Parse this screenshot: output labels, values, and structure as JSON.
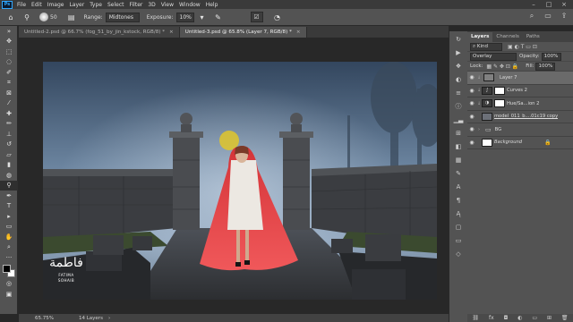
{
  "menubar": {
    "app_logo": "Ps",
    "items": [
      "File",
      "Edit",
      "Image",
      "Layer",
      "Type",
      "Select",
      "Filter",
      "3D",
      "View",
      "Window",
      "Help"
    ]
  },
  "options": {
    "range_label": "Range:",
    "range_value": "Midtones",
    "exposure_label": "Exposure:",
    "exposure_value": "10%",
    "brush_size": "50"
  },
  "tabs": [
    {
      "label": "Untitled-2.psd @ 66.7% (fog_51_by_jin_kstock, RGB/8) *",
      "close": "×"
    },
    {
      "label": "Untitled-3.psd @ 65.8% (Layer 7, RGB/8) *",
      "close": "×"
    }
  ],
  "status": {
    "zoom": "65.75%",
    "info": "14 Layers"
  },
  "layers_panel": {
    "tabs": [
      "Layers",
      "Channels",
      "Paths"
    ],
    "filter_kind": "Kind",
    "blend_mode": "Overlay",
    "opacity_label": "Opacity:",
    "opacity_value": "100%",
    "lock_label": "Lock:",
    "fill_label": "Fill:",
    "fill_value": "100%",
    "layers": [
      {
        "name": "Layer 7"
      },
      {
        "name": "Curves 2"
      },
      {
        "name": "Hue/Sa...ion 2"
      },
      {
        "name": "model_011_b....01c19 copy"
      },
      {
        "name": "BG"
      },
      {
        "name": "Background"
      }
    ]
  },
  "watermark": {
    "arabic": "فاطمة",
    "line1": "FATIMA",
    "line2": "SOHAIB"
  },
  "colors": {
    "ui_bg": "#535353",
    "ui_dark": "#3a3a3a",
    "accent": "#31a8ff",
    "cloak": "#e0393d"
  }
}
